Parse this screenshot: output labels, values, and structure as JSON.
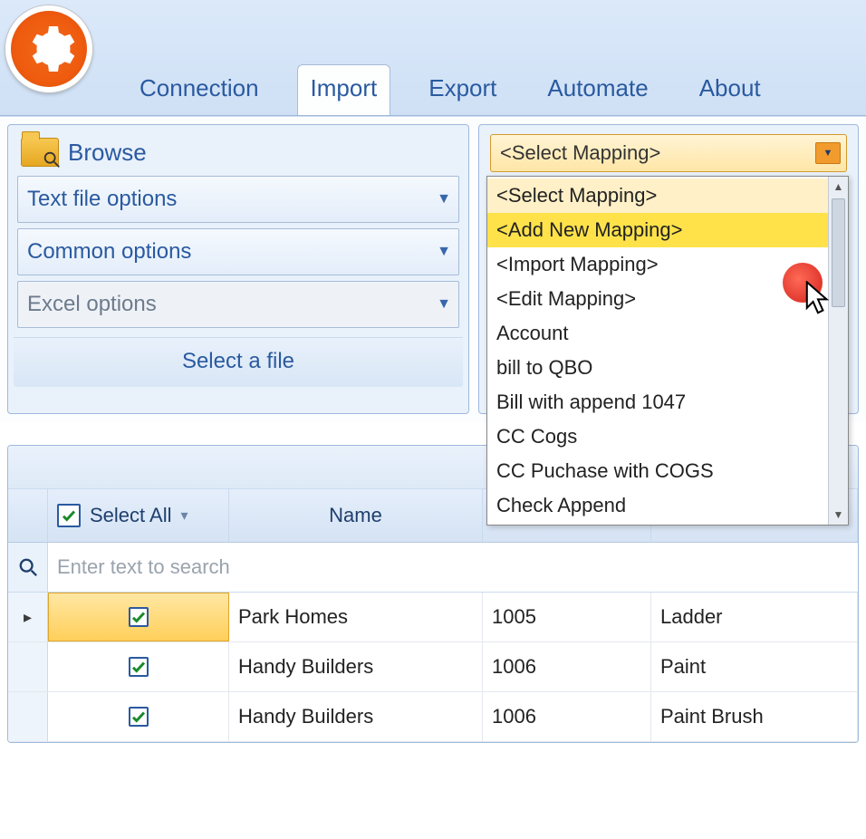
{
  "ribbon": {
    "tabs": [
      "Connection",
      "Import",
      "Export",
      "Automate",
      "About"
    ],
    "active": "Import"
  },
  "left_panel": {
    "browse_label": "Browse",
    "options": [
      {
        "label": "Text file options",
        "enabled": true
      },
      {
        "label": "Common options",
        "enabled": true
      },
      {
        "label": "Excel options",
        "enabled": false
      }
    ],
    "caption": "Select a file"
  },
  "right_panel": {
    "select_label": "<Select Mapping>",
    "dropdown_open": true,
    "items": [
      "<Select Mapping>",
      "<Add New Mapping>",
      "<Import Mapping>",
      "<Edit Mapping>",
      "Account",
      "bill to QBO",
      "Bill with append 1047",
      "CC Cogs",
      "CC Puchase with COGS",
      "Check Append"
    ],
    "highlight_index": 1
  },
  "grid": {
    "select_all_label": "Select All",
    "name_header": "Name",
    "search_placeholder": "Enter text to search",
    "rows": [
      {
        "current": true,
        "checked": true,
        "name": "Park Homes",
        "col3": "1005",
        "col4": "Ladder"
      },
      {
        "current": false,
        "checked": true,
        "name": "Handy Builders",
        "col3": "1006",
        "col4": "Paint"
      },
      {
        "current": false,
        "checked": true,
        "name": "Handy Builders",
        "col3": "1006",
        "col4": "Paint Brush"
      }
    ]
  }
}
